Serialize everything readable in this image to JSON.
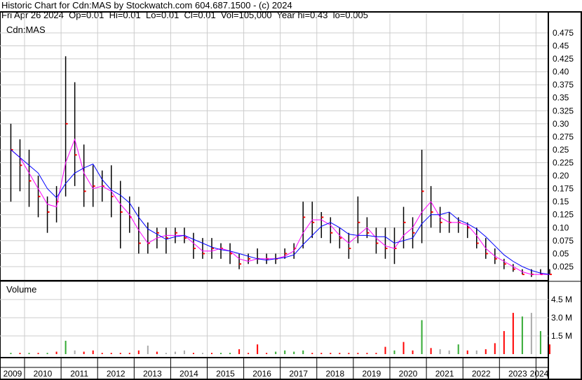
{
  "header": {
    "title": "Historic Chart for Cdn:MAS by Stockwatch.com 604.687.1500 - (c) 2024",
    "quote": "Fri Apr 26 2024  Op=0.01  Hi=0.01  Lo=0.01  Cl=0.01  Vol=105,000  Year hi=0.43  lo=0.005"
  },
  "chart_data": {
    "type": "line",
    "symbol_label": "Cdn:MAS",
    "volume_label": "Volume",
    "x_tick_labels": [
      "2009",
      "2010",
      "2011",
      "2012",
      "2013",
      "2014",
      "2015",
      "2016",
      "2017",
      "2018",
      "2019",
      "2020",
      "2021",
      "2022",
      "2023",
      "2024"
    ],
    "price_ticks": [
      "0.025",
      "0.05",
      "0.075",
      "0.10",
      "0.125",
      "0.15",
      "0.175",
      "0.20",
      "0.225",
      "0.25",
      "0.275",
      "0.30",
      "0.325",
      "0.35",
      "0.375",
      "0.40",
      "0.425",
      "0.45",
      "0.475"
    ],
    "volume_ticks": [
      "1.5 M",
      "3.0 M",
      "4.5 M"
    ],
    "ylim": [
      0,
      0.49
    ],
    "volume_ylim_millions": [
      0,
      5.5
    ],
    "start_year": 2009.5,
    "period": "quarter",
    "high": [
      0.3,
      0.27,
      0.25,
      0.2,
      0.16,
      0.18,
      0.43,
      0.38,
      0.26,
      0.22,
      0.21,
      0.22,
      0.19,
      0.16,
      0.14,
      0.11,
      0.1,
      0.1,
      0.1,
      0.1,
      0.09,
      0.08,
      0.08,
      0.07,
      0.07,
      0.05,
      0.05,
      0.06,
      0.05,
      0.05,
      0.06,
      0.07,
      0.15,
      0.15,
      0.13,
      0.12,
      0.1,
      0.09,
      0.16,
      0.12,
      0.1,
      0.1,
      0.1,
      0.14,
      0.12,
      0.25,
      0.18,
      0.14,
      0.13,
      0.12,
      0.11,
      0.1,
      0.08,
      0.06,
      0.04,
      0.03,
      0.02,
      0.02,
      0.02,
      0.02
    ],
    "low": [
      0.15,
      0.17,
      0.14,
      0.12,
      0.09,
      0.11,
      0.16,
      0.18,
      0.14,
      0.14,
      0.15,
      0.12,
      0.06,
      0.09,
      0.05,
      0.05,
      0.06,
      0.05,
      0.07,
      0.07,
      0.04,
      0.04,
      0.04,
      0.04,
      0.03,
      0.02,
      0.03,
      0.03,
      0.03,
      0.03,
      0.04,
      0.04,
      0.06,
      0.08,
      0.08,
      0.07,
      0.06,
      0.04,
      0.07,
      0.08,
      0.05,
      0.04,
      0.03,
      0.06,
      0.06,
      0.07,
      0.1,
      0.09,
      0.09,
      0.09,
      0.08,
      0.06,
      0.04,
      0.03,
      0.02,
      0.015,
      0.01,
      0.005,
      0.01,
      0.01
    ],
    "close": [
      0.25,
      0.22,
      0.19,
      0.16,
      0.13,
      0.15,
      0.3,
      0.24,
      0.17,
      0.18,
      0.18,
      0.16,
      0.13,
      0.12,
      0.07,
      0.07,
      0.09,
      0.08,
      0.09,
      0.08,
      0.06,
      0.05,
      0.06,
      0.06,
      0.05,
      0.03,
      0.04,
      0.04,
      0.04,
      0.04,
      0.05,
      0.06,
      0.12,
      0.11,
      0.12,
      0.09,
      0.08,
      0.06,
      0.11,
      0.09,
      0.07,
      0.06,
      0.06,
      0.11,
      0.09,
      0.17,
      0.13,
      0.11,
      0.11,
      0.11,
      0.1,
      0.07,
      0.05,
      0.04,
      0.03,
      0.02,
      0.01,
      0.01,
      0.01,
      0.01
    ],
    "volume_millions": [
      0.1,
      0.1,
      0.1,
      0.1,
      0.1,
      0.2,
      1.1,
      0.3,
      0.2,
      0.3,
      0.1,
      0.1,
      0.1,
      0.1,
      0.3,
      0.7,
      0.2,
      0.1,
      0.2,
      0.3,
      0.1,
      0.1,
      0.1,
      0.1,
      0.1,
      0.4,
      0.1,
      0.8,
      0.1,
      0.2,
      0.3,
      0.2,
      0.3,
      0.1,
      0.1,
      0.1,
      0.1,
      0.1,
      0.1,
      0.1,
      0.1,
      0.6,
      0.3,
      1.0,
      0.3,
      2.8,
      0.5,
      0.4,
      0.3,
      0.8,
      0.3,
      0.3,
      0.4,
      0.9,
      1.9,
      3.4,
      3.1,
      3.4,
      1.9,
      0.8
    ],
    "volume_colors": [
      "green",
      "red",
      "green",
      "red",
      "green",
      "red",
      "green",
      "gray",
      "red",
      "red",
      "red",
      "red",
      "red",
      "red",
      "red",
      "gray",
      "red",
      "gray",
      "gray",
      "gray",
      "red",
      "gray",
      "red",
      "green",
      "green",
      "red",
      "red",
      "red",
      "red",
      "green",
      "green",
      "green",
      "green",
      "red",
      "red",
      "red",
      "red",
      "red",
      "red",
      "red",
      "red",
      "red",
      "green",
      "red",
      "red",
      "green",
      "red",
      "gray",
      "gray",
      "green",
      "red",
      "gray",
      "red",
      "red",
      "red",
      "red",
      "green",
      "gray",
      "green",
      "red"
    ],
    "series": [
      {
        "name": "short moving average",
        "color": "#ff00ff",
        "window": 2
      },
      {
        "name": "long moving average",
        "color": "#0000ff",
        "window": 4
      }
    ],
    "colors": {
      "bar": "#000000",
      "close_tick": "#ff0000",
      "vol_up": "#33aa33",
      "vol_down": "#ff0000",
      "vol_flat": "#aaaaaa"
    }
  }
}
